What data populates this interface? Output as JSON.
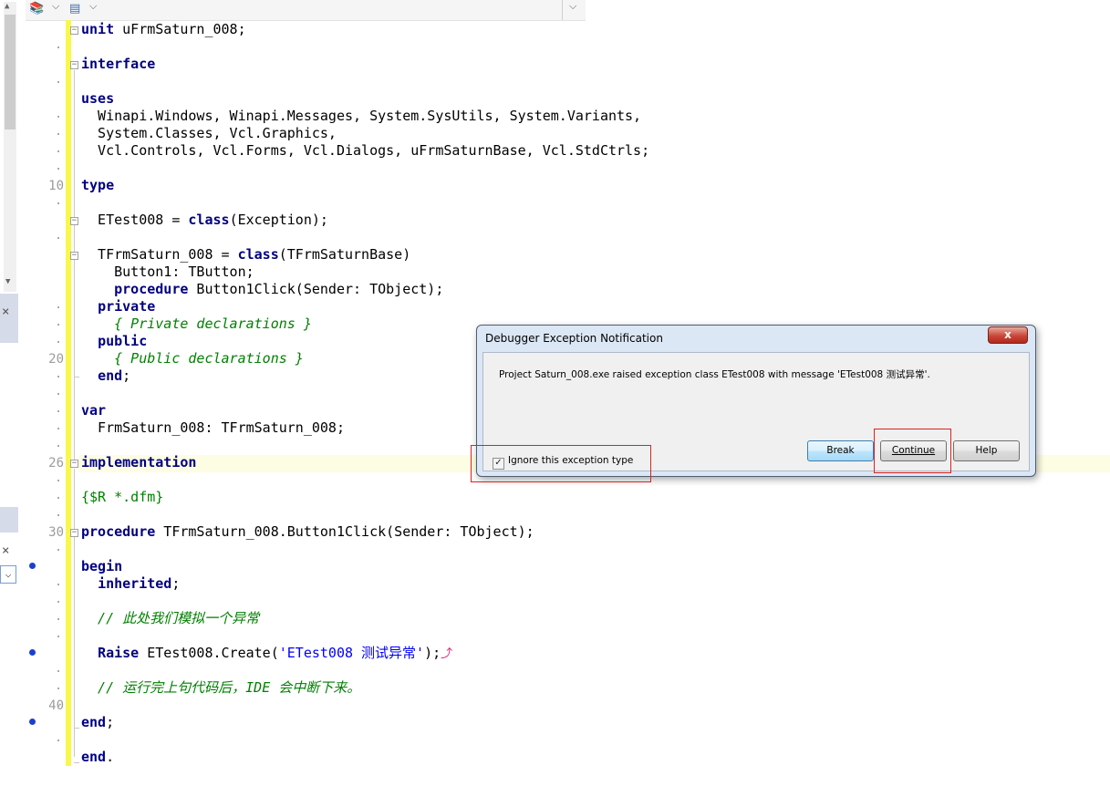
{
  "toolbar": {
    "icons": [
      "books-icon",
      "dropdown-arrow-icon",
      "layout-icon",
      "dropdown-arrow-icon",
      "dropdown-arrow-icon"
    ]
  },
  "gutter": {
    "line_numbers": [
      "10",
      "20",
      "26",
      "30",
      "40"
    ]
  },
  "code_lines": [
    {
      "kw": "unit",
      "rest": " uFrmSaturn_008;"
    },
    {
      "kw": "interface",
      "rest": ""
    },
    {
      "kw": "uses",
      "rest": ""
    },
    {
      "text": "  Winapi.Windows, Winapi.Messages, System.SysUtils, System.Variants,"
    },
    {
      "text": "  System.Classes, Vcl.Graphics,"
    },
    {
      "text": "  Vcl.Controls, Vcl.Forms, Vcl.Dialogs, uFrmSaturnBase, Vcl.StdCtrls;"
    },
    {
      "kw": "type",
      "rest": ""
    },
    {
      "pre": "  ETest008 = ",
      "kw": "class",
      "rest": "(Exception);"
    },
    {
      "pre": "  TFrmSaturn_008 = ",
      "kw": "class",
      "rest": "(TFrmSaturnBase)"
    },
    {
      "text": "    Button1: TButton;"
    },
    {
      "pre": "    ",
      "kw": "procedure",
      "rest": " Button1Click(Sender: TObject);"
    },
    {
      "pre": "  ",
      "kw": "private",
      "rest": ""
    },
    {
      "comment": "    { Private declarations }"
    },
    {
      "pre": "  ",
      "kw": "public",
      "rest": ""
    },
    {
      "comment": "    { Public declarations }"
    },
    {
      "pre": "  ",
      "kw": "end",
      "rest": ";"
    },
    {
      "kw": "var",
      "rest": ""
    },
    {
      "text": "  FrmSaturn_008: TFrmSaturn_008;"
    },
    {
      "kw": "implementation",
      "rest": ""
    },
    {
      "directive": "{$R *.dfm}"
    },
    {
      "kw": "procedure",
      "rest": " TFrmSaturn_008.Button1Click(Sender: TObject);"
    },
    {
      "kw": "begin",
      "rest": ""
    },
    {
      "pre": "  ",
      "kw": "inherited",
      "rest": ";"
    },
    {
      "comment": "  // 此处我们模拟一个异常"
    },
    {
      "pre": "  ",
      "kw": "Raise",
      "rest": " ETest008.Create(",
      "str": "'ETest008 测试异常'",
      "post": ");"
    },
    {
      "comment": "  // 运行完上句代码后，IDE 会中断下来。"
    },
    {
      "kw": "end",
      "rest": ";"
    },
    {
      "kw": "end",
      "rest": "."
    }
  ],
  "dialog": {
    "title": "Debugger Exception Notification",
    "close_label": "x",
    "message": "Project Saturn_008.exe raised exception class ETest008 with message 'ETest008 测试异常'.",
    "checkbox_label": "Ignore this exception type",
    "checkbox_checked": true,
    "buttons": {
      "break": "Break",
      "continue": "Continue",
      "help": "Help"
    }
  },
  "left_panel": {
    "close_label": "×",
    "combo_arrow": "⌵"
  }
}
